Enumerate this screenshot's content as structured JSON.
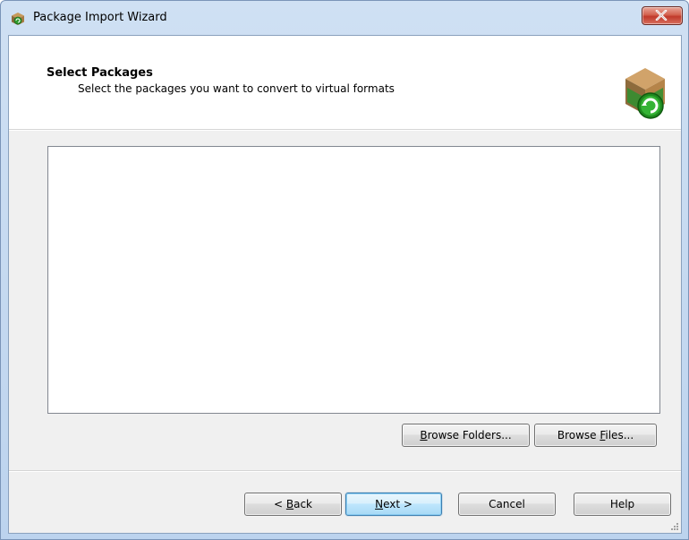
{
  "window": {
    "title": "Package Import Wizard",
    "icon": "package-wizard-icon",
    "close_icon": "close-icon"
  },
  "header": {
    "title": "Select Packages",
    "subtitle": "Select the packages you want to convert to virtual formats",
    "icon": "package-convert-icon"
  },
  "package_list": {
    "items": []
  },
  "buttons": {
    "browse_folders": {
      "text": "Browse Folders...",
      "accel": "B"
    },
    "browse_files": {
      "text": "Browse Files...",
      "accel": "F"
    },
    "back": {
      "text": "< Back",
      "accel": "B"
    },
    "next": {
      "text": "Next >",
      "accel": "N"
    },
    "cancel": {
      "text": "Cancel"
    },
    "help": {
      "text": "Help"
    }
  },
  "colors": {
    "close_button": "#c0392b",
    "default_button_border": "#3c7fb1",
    "list_border": "#828790"
  }
}
